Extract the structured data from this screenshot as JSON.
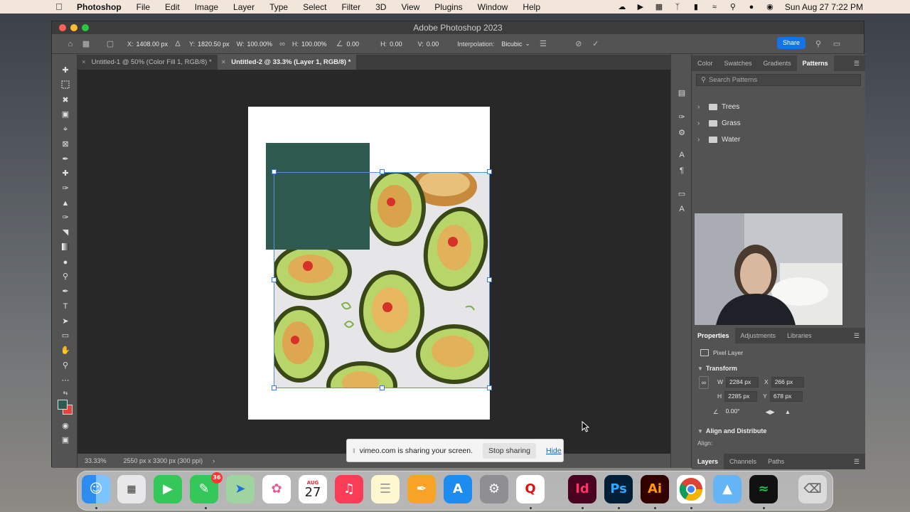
{
  "menubar": {
    "app": "Photoshop",
    "items": [
      "File",
      "Edit",
      "Image",
      "Layer",
      "Type",
      "Select",
      "Filter",
      "3D",
      "View",
      "Plugins",
      "Window",
      "Help"
    ],
    "clock": "Sun Aug 27  7:22 PM"
  },
  "window": {
    "title": "Adobe Photoshop 2023"
  },
  "options": {
    "x_label": "X:",
    "x_value": "1408.00 px",
    "y_label": "Y:",
    "y_value": "1820.50 px",
    "w_label": "W:",
    "w_value": "100.00%",
    "h_label": "H:",
    "h_value": "100.00%",
    "angle_value": "0.00",
    "hskew_label": "H:",
    "hskew_value": "0.00",
    "vskew_label": "V:",
    "vskew_value": "0.00",
    "interp_label": "Interpolation:",
    "interp_value": "Bicubic",
    "share_label": "Share"
  },
  "tabs": [
    {
      "label": "Untitled-1 @ 50% (Color Fill 1, RGB/8) *"
    },
    {
      "label": "Untitled-2 @ 33.3% (Layer 1, RGB/8) *"
    }
  ],
  "status": {
    "zoom": "33.33%",
    "doc_info": "2550 px x 3300 px (300 ppi)"
  },
  "patterns_panel": {
    "tabs": [
      "Color",
      "Swatches",
      "Gradients",
      "Patterns"
    ],
    "search_placeholder": "Search Patterns",
    "folders": [
      "Trees",
      "Grass",
      "Water"
    ]
  },
  "properties_panel": {
    "tabs": [
      "Properties",
      "Adjustments",
      "Libraries"
    ],
    "layer_type": "Pixel Layer",
    "transform_header": "Transform",
    "w_label": "W",
    "w_value": "2284 px",
    "x_label": "X",
    "x_value": "266 px",
    "h_label": "H",
    "h_value": "2285 px",
    "y_label": "Y",
    "y_value": "678 px",
    "angle_value": "0.00°",
    "align_header": "Align and Distribute",
    "align_label": "Align:"
  },
  "layers_panel": {
    "tabs": [
      "Layers",
      "Channels",
      "Paths"
    ]
  },
  "share_banner": {
    "message": "vimeo.com is sharing your screen.",
    "stop": "Stop sharing",
    "hide": "Hide"
  },
  "dock": {
    "calendar_month": "AUG",
    "calendar_day": "27",
    "messages_badge": "36",
    "apps": [
      "Finder",
      "Launchpad",
      "FaceTime",
      "Messages",
      "Maps",
      "Photos",
      "Calendar",
      "Music",
      "Notes",
      "Pages",
      "App Store",
      "System Settings",
      "Quicken",
      "InDesign",
      "Photoshop",
      "Illustrator",
      "Chrome",
      "Finder Preview",
      "Spotify",
      "Trash"
    ],
    "id_label": "Id",
    "ps_label": "Ps",
    "ai_label": "Ai",
    "q_label": "Q"
  },
  "colors": {
    "accent": "#1473e6",
    "fill_green": "#2e5a50",
    "fg_swatch": "#2e5a50",
    "bg_swatch": "#e8413b"
  }
}
